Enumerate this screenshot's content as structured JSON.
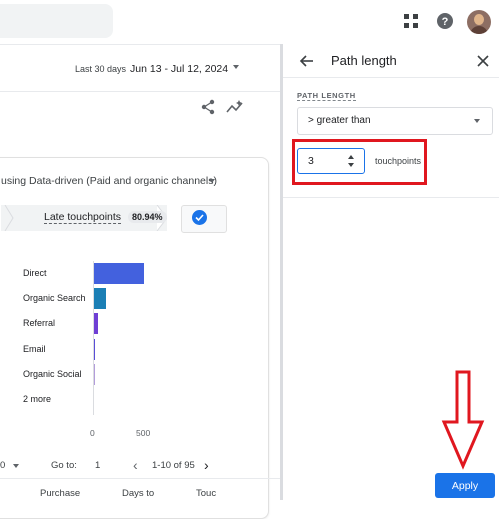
{
  "topbar": {
    "apps_icon": "grid-apps-icon",
    "help_icon": "help-circle-icon",
    "avatar": "user-avatar"
  },
  "report": {
    "date_prefix": "Last 30 days",
    "date_range": "Jun 13 - Jul 12, 2024",
    "card_title": "using Data-driven (Paid and organic channels)",
    "touchpoint_label": "Late touchpoints",
    "touchpoint_badge": "80.94%",
    "bars": [
      {
        "label": "Direct",
        "value": 530,
        "color": "#4361de"
      },
      {
        "label": "Organic Search",
        "value": 140,
        "color": "#1b7fb5"
      },
      {
        "label": "Referral",
        "value": 55,
        "color": "#6f3fd4"
      },
      {
        "label": "Email",
        "value": 10,
        "color": "#5a4ed6"
      },
      {
        "label": "Organic Social",
        "value": 5,
        "color": "#b39ddb"
      },
      {
        "label": "2 more",
        "value": 0,
        "color": "#dadce0"
      }
    ],
    "axis_ticks": [
      "0",
      "500"
    ],
    "pager": {
      "rows_value": "0",
      "goto_label": "Go to:",
      "goto_value": "1",
      "range": "1-10 of 95"
    },
    "columns": [
      "Purchase",
      "Days to",
      "Touc"
    ]
  },
  "panel": {
    "title": "Path length",
    "field_label": "PATH LENGTH",
    "operator": "> greater than",
    "value": "3",
    "unit": "touchpoints",
    "apply_label": "Apply"
  },
  "colors": {
    "accent": "#1a73e8",
    "annotation": "#e0171f"
  }
}
